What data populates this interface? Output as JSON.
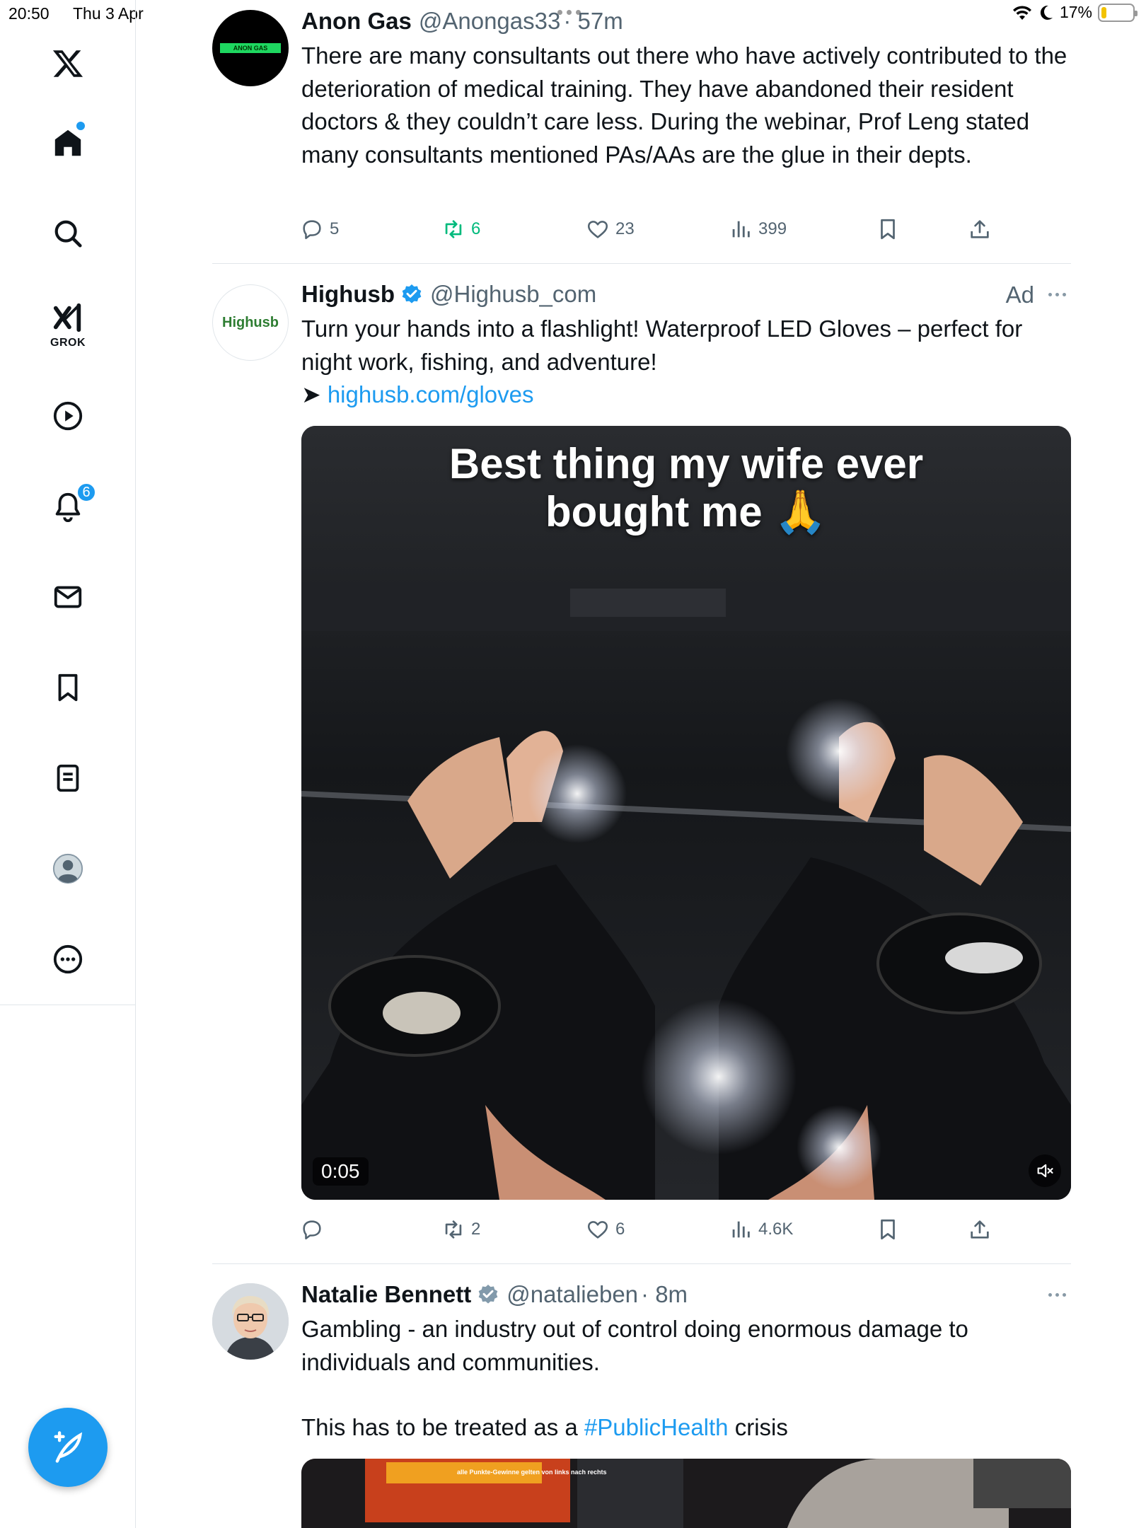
{
  "status_bar": {
    "time": "20:50",
    "date": "Thu 3 Apr",
    "battery": "17%",
    "battery_level": 0.17
  },
  "sidebar": {
    "items": [
      {
        "name": "x-logo"
      },
      {
        "name": "home",
        "active": true,
        "has_dot": true
      },
      {
        "name": "search"
      },
      {
        "name": "grok",
        "label": "GROK"
      },
      {
        "name": "video"
      },
      {
        "name": "notifications",
        "badge": "6"
      },
      {
        "name": "messages"
      },
      {
        "name": "bookmarks"
      },
      {
        "name": "lists"
      },
      {
        "name": "profile"
      },
      {
        "name": "more"
      }
    ],
    "compose_label": "Post"
  },
  "tweets": [
    {
      "avatar_text": "ANON GAS",
      "name": "Anon Gas",
      "handle": "@Anongas33",
      "time": "· 57m",
      "text": "There are many consultants out there who have actively contributed to the deterioration of medical training. They have abandoned their resident doctors & they couldn’t care less. During the webinar, Prof Leng stated many consultants mentioned PAs/AAs are the glue in their depts.",
      "replies": "5",
      "retweets": "6",
      "likes": "23",
      "views": "399"
    },
    {
      "avatar_text": "Highusb",
      "name": "Highusb",
      "handle": "@Highusb_com",
      "ad_label": "Ad",
      "text": "Turn your hands into a flashlight! Waterproof LED Gloves – perfect for night work, fishing, and adventure!",
      "link_prefix": "➤ ",
      "link": "highusb.com/gloves",
      "video": {
        "caption_line1": "Best thing my wife ever",
        "caption_line2": "bought me 🙏",
        "duration": "0:05"
      },
      "replies": "",
      "retweets": "2",
      "likes": "6",
      "views": "4.6K"
    },
    {
      "name": "Natalie Bennett",
      "handle": "@natalieben",
      "time": "· 8m",
      "text_line1": "Gambling - an industry out of control doing enormous damage to individuals and communities.",
      "text_line2_prefix": "This has to be treated as a ",
      "hashtag": "#PublicHealth",
      "text_line2_suffix": " crisis",
      "media_caption": "alle Punkte-Gewinne gelten von links nach rechts"
    }
  ],
  "colors": {
    "accent": "#1d9bf0",
    "retweet_green": "#00ba7c",
    "secondary_text": "#536471",
    "verified_grey": "#829aab"
  }
}
